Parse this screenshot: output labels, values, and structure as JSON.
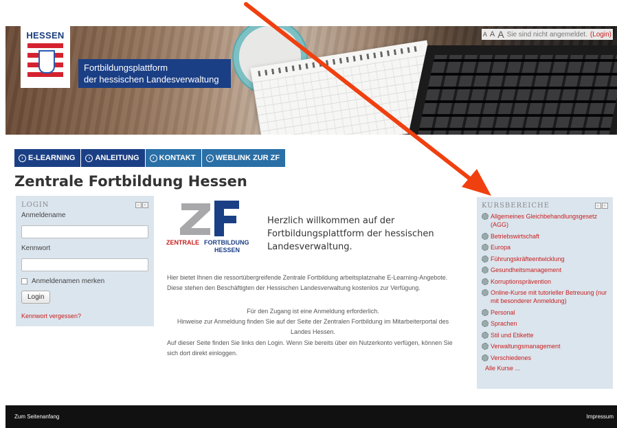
{
  "header": {
    "logo_text": "HESSEN",
    "brand_line1": "Fortbildungsplattform",
    "brand_line2": "der hessischen Landesverwaltung",
    "font_sizes": [
      "A",
      "A",
      "A"
    ],
    "login_status": "Sie sind nicht angemeldet.",
    "login_link": "(Login)"
  },
  "nav": {
    "items": [
      {
        "label": "E-LEARNING"
      },
      {
        "label": "ANLEITUNG"
      },
      {
        "label": "KONTAKT"
      },
      {
        "label": "WEBLINK ZUR ZF"
      }
    ]
  },
  "page": {
    "title": "Zentrale Fortbildung Hessen"
  },
  "login_block": {
    "heading": "LOGIN",
    "username_label": "Anmeldename",
    "username_value": "",
    "password_label": "Kennwort",
    "password_value": "",
    "remember_label": "Anmeldenamen merken",
    "login_button": "Login",
    "forgot_link": "Kennwort vergessen?"
  },
  "main": {
    "zf_logo": {
      "line1": "ZENTRALE",
      "line2": "FORTBILDUNG",
      "line3": "HESSEN"
    },
    "welcome": "Herzlich willkommen auf der Fortbildungsplattform der hessischen Landesverwaltung.",
    "intro": "Hier bietet Ihnen die ressortübergreifende Zentrale Fortbildung arbeitsplatznahe E-Learning-Angebote. Diese stehen den Beschäftigten der Hessischen Landesverwaltung kostenlos zur Verfügung.",
    "access_line1": "Für den Zugang ist eine Anmeldung erforderlich.",
    "access_line2": "Hinweise zur Anmeldung finden Sie auf der Seite der Zentralen Fortbildung im Mitarbeiterportal des Landes Hessen.",
    "find": "Auf dieser Seite finden Sie links den Login. Wenn Sie bereits über ein Nutzerkonto verfügen, können Sie sich dort direkt einloggen."
  },
  "course_block": {
    "heading": "KURSBEREICHE",
    "items": [
      {
        "label": "Allgemeines Gleichbehandlungsgesetz (AGG)"
      },
      {
        "label": "Betriebswirtschaft"
      },
      {
        "label": "Europa"
      },
      {
        "label": "Führungskräfteentwicklung"
      },
      {
        "label": "Gesundheitsmanagement"
      },
      {
        "label": "Korruptionsprävention"
      },
      {
        "label": "Online-Kurse mit tutorieller Betreuung (nur mit besonderer Anmeldung)"
      },
      {
        "label": "Personal"
      },
      {
        "label": "Sprachen"
      },
      {
        "label": "Stil und Etikette"
      },
      {
        "label": "Verwaltungsmanagement"
      },
      {
        "label": "Verschiedenes"
      }
    ],
    "all_courses": "Alle Kurse ..."
  },
  "footer": {
    "top_link": "Zum Seitenanfang",
    "imprint": "Impressum"
  },
  "colors": {
    "brand_blue": "#1b3f85",
    "nav_light_blue": "#2a6fa6",
    "link_red": "#c8201e",
    "block_bg": "#dbe5ee",
    "annotation_arrow": "#f04010"
  }
}
